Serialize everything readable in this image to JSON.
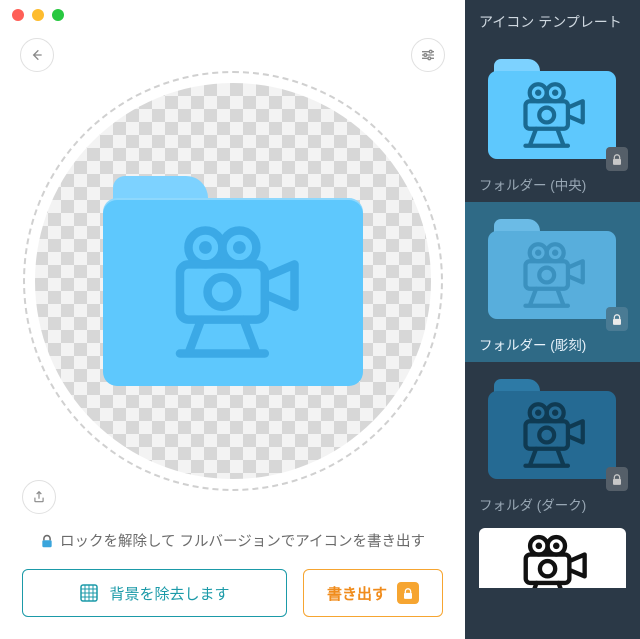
{
  "sidebar": {
    "title": "アイコン テンプレート",
    "templates": [
      {
        "label": "フォルダー (中央)"
      },
      {
        "label": "フォルダー (彫刻)"
      },
      {
        "label": "フォルダ (ダーク)"
      }
    ]
  },
  "footer": {
    "unlock_text": "ロックを解除して フルバージョンでアイコンを書き出す",
    "remove_bg_label": "背景を除去します",
    "export_label": "書き出す"
  },
  "icons": {
    "back": "back-arrow-icon",
    "settings": "sliders-icon",
    "share": "share-icon",
    "lock": "lock-icon",
    "remove_bg": "erase-bg-icon"
  }
}
